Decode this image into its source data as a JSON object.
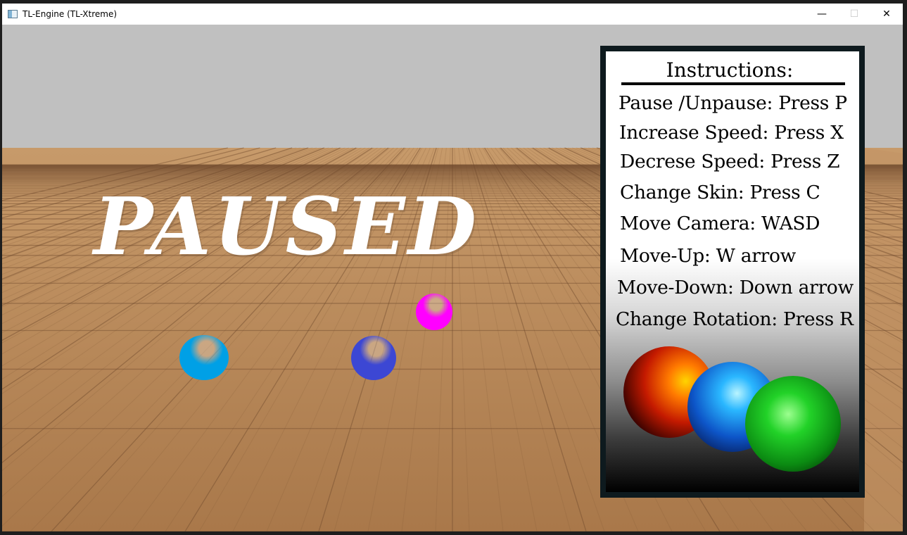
{
  "window": {
    "title": "TL-Engine (TL-Xtreme)",
    "minimize_glyph": "—",
    "maximize_glyph": "☐",
    "close_glyph": "✕"
  },
  "scene": {
    "paused_text": "PAUSED",
    "sky_color": "#c0c0c0",
    "floor_color": "#b07e4f",
    "balls": [
      {
        "name": "light-blue",
        "color": "#00a0e6"
      },
      {
        "name": "dark-blue",
        "color": "#3c47d4"
      },
      {
        "name": "magenta",
        "color": "#ff00ff"
      }
    ]
  },
  "instructions": {
    "title": "Instructions:",
    "items": [
      "Pause /Unpause: Press P",
      "Increase Speed: Press X",
      "Decrese Speed: Press Z",
      "Change Skin: Press C",
      "Move Camera: WASD",
      "Move-Up: W arrow",
      "Move-Down: Down arrow",
      "Change Rotation: Press R"
    ],
    "sphere_colors": [
      "#d52a00",
      "#1a6fd6",
      "#14b01e"
    ]
  }
}
